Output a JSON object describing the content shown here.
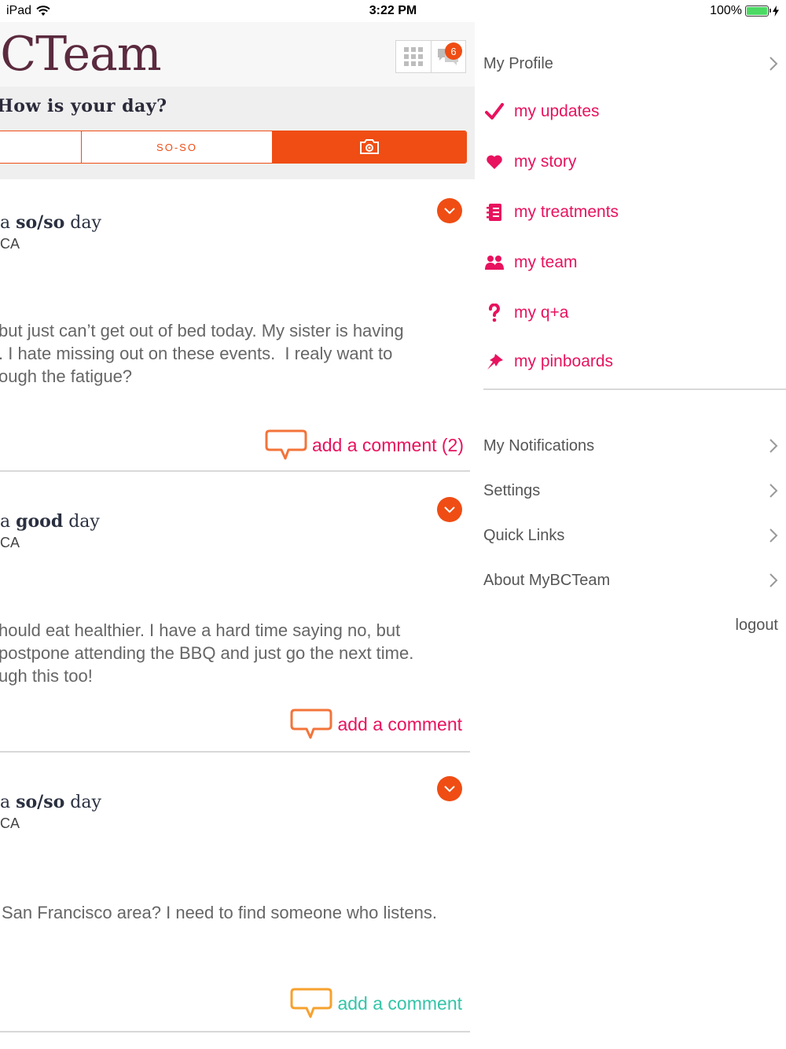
{
  "status_bar": {
    "device": "iPad",
    "time": "3:22 PM",
    "battery": "100%",
    "battery_level": 1.0
  },
  "header": {
    "brand": "BCTeam",
    "notification_count": "6"
  },
  "mood": {
    "question": "How is your day?",
    "options": [
      "",
      "SO-SO",
      "camera-icon"
    ]
  },
  "posts": [
    {
      "title_prefix": "a ",
      "title_mood": "so/so",
      "title_suffix": " day",
      "location": "CA",
      "body": "but just can’t get out of bed today. My sister is having\n. I hate missing out on these events.  I realy want to\nough the fatigue?",
      "comment_label": "add a comment  (2)",
      "comment_color": "#e8125e"
    },
    {
      "title_prefix": "a ",
      "title_mood": "good",
      "title_suffix": " day",
      "location": "CA",
      "body": "hould eat healthier. I have a hard time saying no, but\npostpone attending the BBQ and just go the next time.\nugh this too!",
      "comment_label": "add a comment",
      "comment_color": "#e8125e"
    },
    {
      "title_prefix": "a ",
      "title_mood": "so/so",
      "title_suffix": " day",
      "location": "CA",
      "body": "San Francisco area? I need to find someone who listens.",
      "comment_label": "add a comment",
      "comment_color": "#33c4a8"
    }
  ],
  "menu": {
    "profile": "My Profile",
    "items": [
      {
        "label": "my updates",
        "icon": "checkmark-icon"
      },
      {
        "label": "my story",
        "icon": "heart-icon"
      },
      {
        "label": "my treatments",
        "icon": "notebook-icon"
      },
      {
        "label": "my team",
        "icon": "people-icon"
      },
      {
        "label": "my q+a",
        "icon": "question-icon"
      },
      {
        "label": "my pinboards",
        "icon": "pin-icon"
      }
    ],
    "links": [
      "My Notifications",
      "Settings",
      "Quick Links",
      "About MyBCTeam"
    ],
    "logout": "logout"
  },
  "colors": {
    "accent": "#ef4d14",
    "menu_pink": "#e8125e",
    "brand": "#5b2a3e"
  }
}
